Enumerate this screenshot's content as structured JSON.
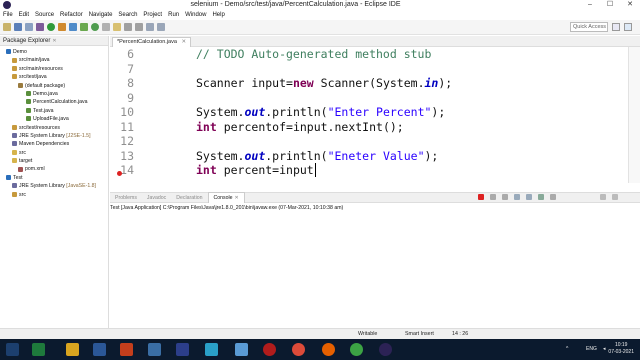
{
  "window": {
    "title": "selenium - Demo/src/test/java/PercentCalculation.java - Eclipse IDE",
    "minimize": "–",
    "maximize": "☐",
    "close": "✕"
  },
  "menu": [
    "File",
    "Edit",
    "Source",
    "Refactor",
    "Navigate",
    "Search",
    "Project",
    "Run",
    "Window",
    "Help"
  ],
  "toolbar": {
    "quick_access_placeholder": "Quick Access"
  },
  "package_explorer": {
    "tab_label": "Package Explorer",
    "close": "✕",
    "tree": [
      {
        "label": "Demo",
        "icon": "project-icon",
        "color": "#2a6ebb"
      },
      {
        "label": "src/main/java",
        "icon": "source-folder-icon",
        "color": "#c79a3d"
      },
      {
        "label": "src/main/resources",
        "icon": "source-folder-icon",
        "color": "#c79a3d"
      },
      {
        "label": "src/test/java",
        "icon": "source-folder-icon",
        "color": "#c79a3d"
      },
      {
        "label": "(default package)",
        "icon": "package-icon",
        "color": "#9a7b3e"
      },
      {
        "label": "Demo.java",
        "icon": "java-file-icon",
        "color": "#5a8f3c"
      },
      {
        "label": "PercentCalculation.java",
        "icon": "java-file-icon",
        "color": "#5a8f3c"
      },
      {
        "label": "Test.java",
        "icon": "java-file-icon",
        "color": "#5a8f3c"
      },
      {
        "label": "UploadFile.java",
        "icon": "java-file-icon",
        "color": "#5a8f3c"
      },
      {
        "label": "src/test/resources",
        "icon": "source-folder-icon",
        "color": "#c79a3d"
      },
      {
        "label": "JRE System Library",
        "suffix": " [J2SE-1.5]",
        "icon": "library-icon",
        "color": "#6b6b9e"
      },
      {
        "label": "Maven Dependencies",
        "icon": "library-icon",
        "color": "#6b6b9e"
      },
      {
        "label": "src",
        "icon": "folder-icon",
        "color": "#d6b44c"
      },
      {
        "label": "target",
        "icon": "folder-icon",
        "color": "#d6b44c"
      },
      {
        "label": "pom.xml",
        "icon": "xml-file-icon",
        "color": "#a05050"
      },
      {
        "label": "Test",
        "icon": "project-icon",
        "color": "#2a6ebb"
      },
      {
        "label": "JRE System Library",
        "suffix": " [JavaSE-1.8]",
        "icon": "library-icon",
        "color": "#6b6b9e"
      },
      {
        "label": "src",
        "icon": "source-folder-icon",
        "color": "#c79a3d"
      }
    ]
  },
  "editor": {
    "tab_label": "*PercentCalculation.java",
    "close": "✕",
    "line_numbers": [
      "6",
      "7",
      "8",
      "9",
      "10",
      "11",
      "12",
      "13",
      "14"
    ],
    "lines": {
      "l6_comment": "// TODO Auto-generated method stub",
      "l8_a": "Scanner input=",
      "l8_kw": "new",
      "l8_b": " Scanner(System.",
      "l8_fld": "in",
      "l8_c": ");",
      "l10_a": "System.",
      "l10_fld": "out",
      "l10_b": ".println(",
      "l10_str": "\"Enter Percent\"",
      "l10_c": ");",
      "l11_kw": "int",
      "l11_a": " percentof=input.nextInt();",
      "l13_a": "System.",
      "l13_fld": "out",
      "l13_b": ".println(",
      "l13_str": "\"Eneter Value\"",
      "l13_c": ");",
      "l14_kw": "int",
      "l14_a": " percent=input"
    }
  },
  "bottom_panel": {
    "tabs": [
      "Problems",
      "Javadoc",
      "Declaration",
      "Console"
    ],
    "active_tab": "Console",
    "console_close": "✕",
    "console_line": "Test [Java Application] C:\\Program Files\\Java\\jre1.8.0_201\\bin\\javaw.exe (07-Mar-2021, 10:10:38 am)"
  },
  "status_bar": {
    "mode": "Writable",
    "insert": "Smart Insert",
    "position": "14 : 26"
  },
  "taskbar": {
    "language": "ENG",
    "time": "10:19",
    "date": "07-03-2021"
  }
}
